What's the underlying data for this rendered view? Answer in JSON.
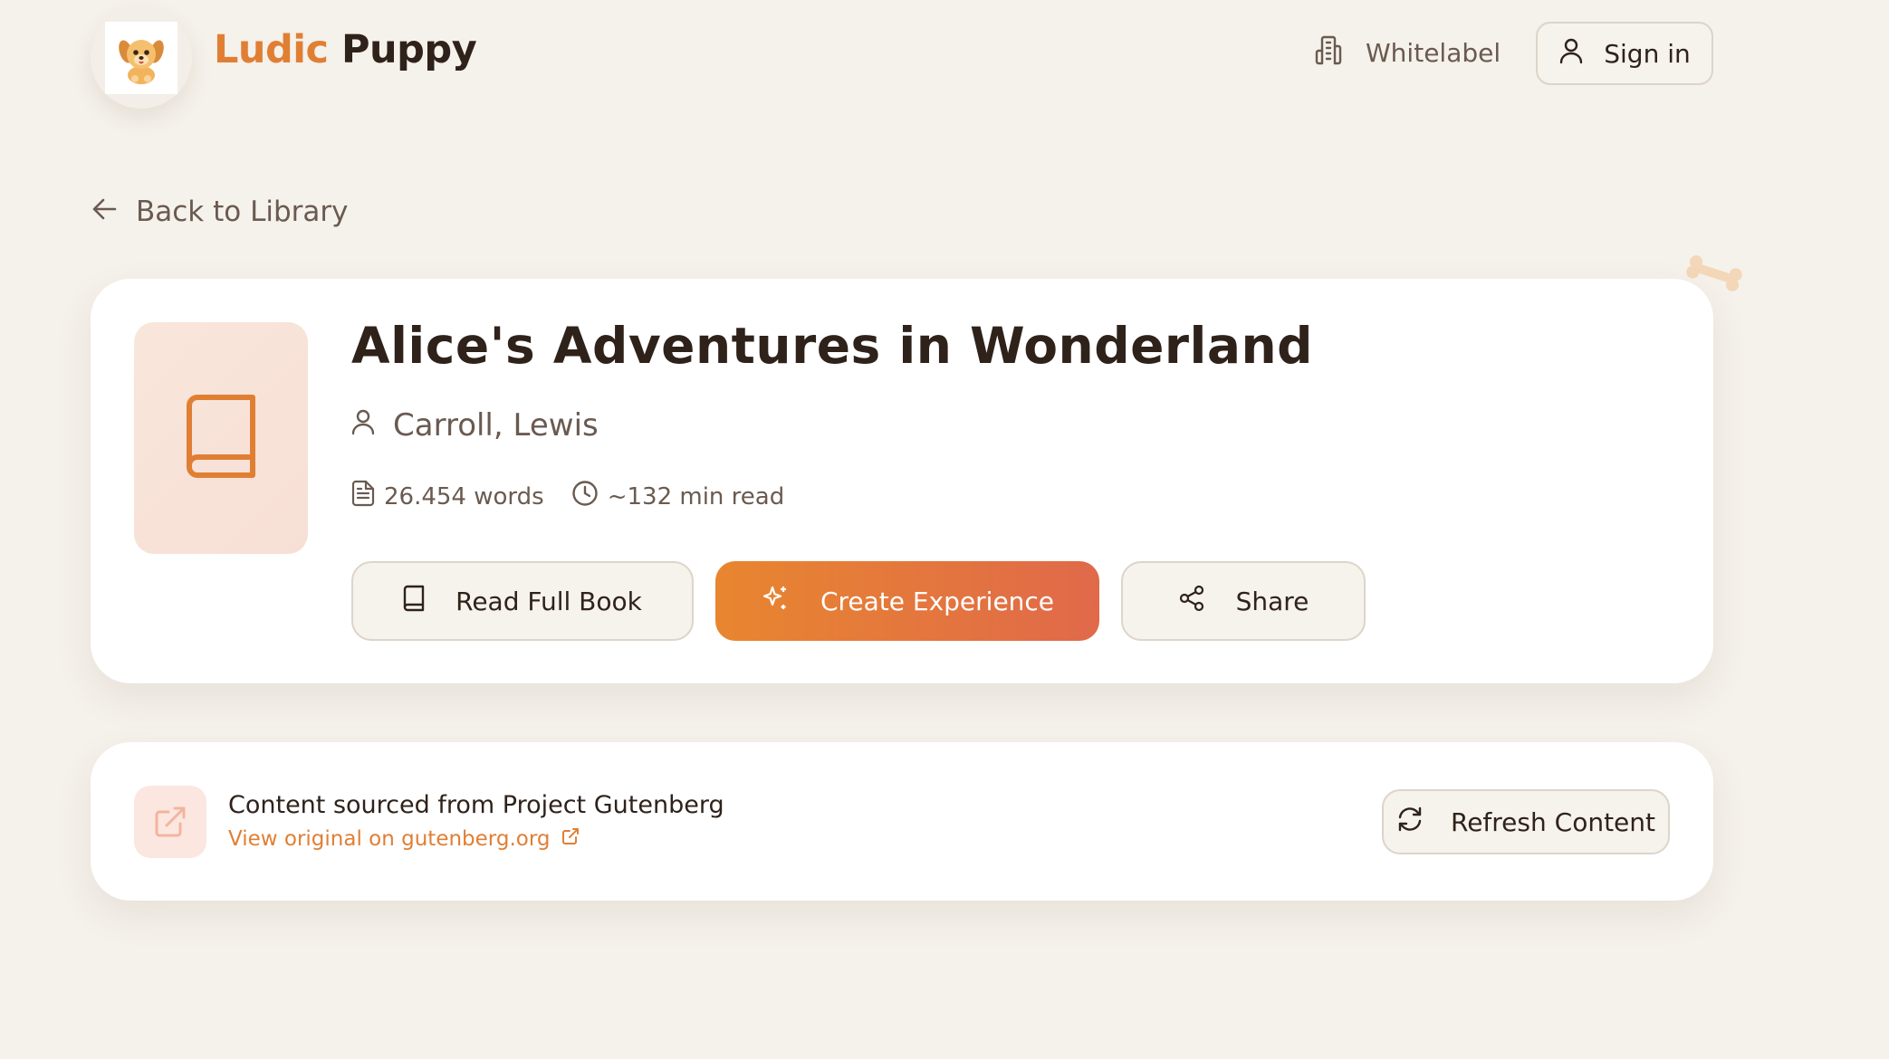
{
  "header": {
    "brand_part1": "Ludic",
    "brand_part2": "Puppy",
    "whitelabel_label": "Whitelabel",
    "signin_label": "Sign in"
  },
  "nav": {
    "back_label": "Back to Library"
  },
  "book": {
    "title": "Alice's Adventures in Wonderland",
    "author": "Carroll, Lewis",
    "words": "26.454 words",
    "read_time": "~132 min read",
    "buttons": {
      "read": "Read Full Book",
      "create": "Create Experience",
      "share": "Share"
    }
  },
  "source": {
    "title": "Content sourced from Project Gutenberg",
    "link": "View original on gutenberg.org",
    "refresh": "Refresh Content"
  },
  "colors": {
    "accent": "#e07f34",
    "background": "#f5f1eb",
    "text_dark": "#2f221a",
    "text_muted": "#6a5a50"
  },
  "icons": {
    "logo": "puppy-logo-icon",
    "whitelabel": "building-icon",
    "signin": "user-icon",
    "back": "arrow-left-icon",
    "cover": "book-icon",
    "author": "user-icon",
    "words": "document-icon",
    "read_time": "clock-icon",
    "read": "book-icon",
    "create": "sparkles-icon",
    "share": "share-icon",
    "source": "external-link-icon",
    "refresh": "refresh-icon"
  }
}
